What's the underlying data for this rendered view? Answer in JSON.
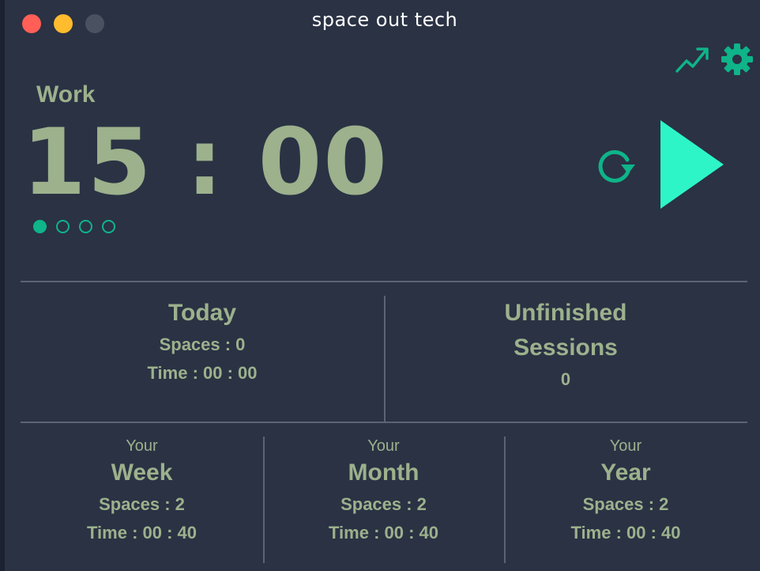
{
  "window": {
    "title": "space out tech"
  },
  "header": {
    "stats_icon": "trending-up-icon",
    "settings_icon": "gear-icon"
  },
  "timer": {
    "mode": "Work",
    "display": "15 : 00",
    "sessions_total": 4,
    "sessions_completed": 1
  },
  "controls": {
    "reset_icon": "refresh-icon",
    "play_icon": "play-icon"
  },
  "today": {
    "title": "Today",
    "spaces": "Spaces : 0",
    "time": "Time : 00 : 00"
  },
  "unfinished": {
    "title_line1": "Unfinished",
    "title_line2": "Sessions",
    "count": "0"
  },
  "week": {
    "prefix": "Your",
    "title": "Week",
    "spaces": "Spaces : 2",
    "time": "Time : 00 : 40"
  },
  "month": {
    "prefix": "Your",
    "title": "Month",
    "spaces": "Spaces : 2",
    "time": "Time : 00 : 40"
  },
  "year": {
    "prefix": "Your",
    "title": "Year",
    "spaces": "Spaces : 2",
    "time": "Time : 00 : 40"
  },
  "colors": {
    "background": "#2a3244",
    "text": "#9cb18c",
    "accent": "#0fb489",
    "play": "#2ef5c8",
    "divider": "#5b6376"
  }
}
